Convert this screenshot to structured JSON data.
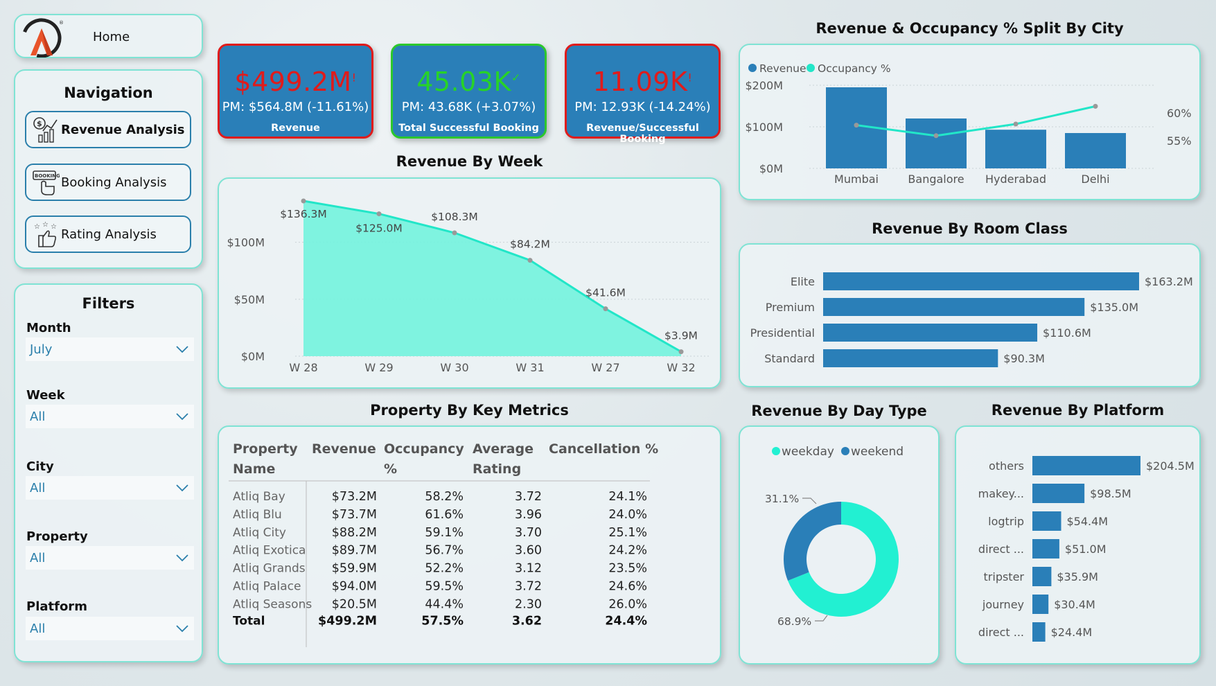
{
  "sidebar": {
    "home_label": "Home",
    "navigation_title": "Navigation",
    "nav_items": [
      "Revenue Analysis",
      "Booking Analysis",
      "Rating Analysis"
    ],
    "filters_title": "Filters",
    "filters": [
      {
        "label": "Month",
        "value": "July"
      },
      {
        "label": "Week",
        "value": "All"
      },
      {
        "label": "City",
        "value": "All"
      },
      {
        "label": "Property",
        "value": "All"
      },
      {
        "label": "Platform",
        "value": "All"
      }
    ]
  },
  "kpis": [
    {
      "value": "$499.2M",
      "mark": "!",
      "pm": "PM: $564.8M (-11.61%)",
      "label": "Revenue",
      "status": "down",
      "value_color": "#e01b1b"
    },
    {
      "value": "45.03K",
      "mark": "✓",
      "pm": "PM: 43.68K (+3.07%)",
      "label": "Total Successful Booking",
      "status": "up",
      "value_color": "#27d327"
    },
    {
      "value": "11.09K",
      "mark": "!",
      "pm": "PM: 12.93K (-14.24%)",
      "label": "Revenue/Successful Booking",
      "status": "down",
      "value_color": "#e01b1b"
    }
  ],
  "chart_data": [
    {
      "id": "week",
      "type": "area",
      "title": "Revenue By Week",
      "categories": [
        "W 28",
        "W 29",
        "W 30",
        "W 31",
        "W 27",
        "W 32"
      ],
      "values": [
        136.3,
        125.0,
        108.3,
        84.2,
        41.6,
        3.9
      ],
      "labels": [
        "$136.3M",
        "$125.0M",
        "$108.3M",
        "$84.2M",
        "$41.6M",
        "$3.9M"
      ],
      "yticks": [
        "$0M",
        "$50M",
        "$100M"
      ],
      "ylim": [
        0,
        136.3
      ],
      "color": "#22e6c8"
    },
    {
      "id": "city",
      "type": "bar",
      "title": "Revenue & Occupancy % Split By City",
      "categories": [
        "Mumbai",
        "Bangalore",
        "Hyderabad",
        "Delhi"
      ],
      "series": [
        {
          "name": "Revenue",
          "values": [
            195,
            120,
            93,
            85
          ],
          "color": "#2a7fb8"
        },
        {
          "name": "Occupancy %",
          "values": [
            57.8,
            55.9,
            58.0,
            61.2
          ],
          "color": "#22e6c8"
        }
      ],
      "yticks_left": [
        "$0M",
        "$100M",
        "$200M"
      ],
      "yticks_right": [
        "55%",
        "60%"
      ],
      "ylim_left": [
        0,
        200
      ],
      "ylim_right": [
        50,
        65
      ]
    },
    {
      "id": "room",
      "type": "bar",
      "title": "Revenue By Room Class",
      "categories": [
        "Elite",
        "Premium",
        "Presidential",
        "Standard"
      ],
      "values": [
        163.2,
        135.0,
        110.6,
        90.3
      ],
      "labels": [
        "$163.2M",
        "$135.0M",
        "$110.6M",
        "$90.3M"
      ],
      "color": "#2a7fb8"
    },
    {
      "id": "daytype",
      "type": "pie",
      "title": "Revenue By Day Type",
      "categories": [
        "weekday",
        "weekend"
      ],
      "values": [
        68.9,
        31.1
      ],
      "labels": [
        "68.9%",
        "31.1%"
      ],
      "colors": [
        "#22f0d2",
        "#2a7fb8"
      ]
    },
    {
      "id": "platform",
      "type": "bar",
      "title": "Revenue By Platform",
      "categories": [
        "others",
        "makey...",
        "logtrip",
        "direct ...",
        "tripster",
        "journey",
        "direct ..."
      ],
      "values": [
        204.5,
        98.5,
        54.4,
        51.0,
        35.9,
        30.4,
        24.4
      ],
      "labels": [
        "$204.5M",
        "$98.5M",
        "$54.4M",
        "$51.0M",
        "$35.9M",
        "$30.4M",
        "$24.4M"
      ],
      "color": "#2a7fb8"
    },
    {
      "id": "property",
      "type": "table",
      "title": "Property By Key Metrics",
      "columns": [
        "Property Name",
        "Revenue",
        "Occupancy %",
        "Average Rating",
        "Cancellation %"
      ],
      "rows": [
        [
          "Atliq Bay",
          "$73.2M",
          "58.2%",
          "3.72",
          "24.1%"
        ],
        [
          "Atliq Blu",
          "$73.7M",
          "61.6%",
          "3.96",
          "24.0%"
        ],
        [
          "Atliq City",
          "$88.2M",
          "59.1%",
          "3.70",
          "25.1%"
        ],
        [
          "Atliq Exotica",
          "$89.7M",
          "56.7%",
          "3.60",
          "24.2%"
        ],
        [
          "Atliq Grands",
          "$59.9M",
          "52.2%",
          "3.12",
          "23.5%"
        ],
        [
          "Atliq Palace",
          "$94.0M",
          "59.5%",
          "3.72",
          "24.6%"
        ],
        [
          "Atliq Seasons",
          "$20.5M",
          "44.4%",
          "2.30",
          "26.0%"
        ]
      ],
      "total": [
        "Total",
        "$499.2M",
        "57.5%",
        "3.62",
        "24.4%"
      ]
    }
  ]
}
